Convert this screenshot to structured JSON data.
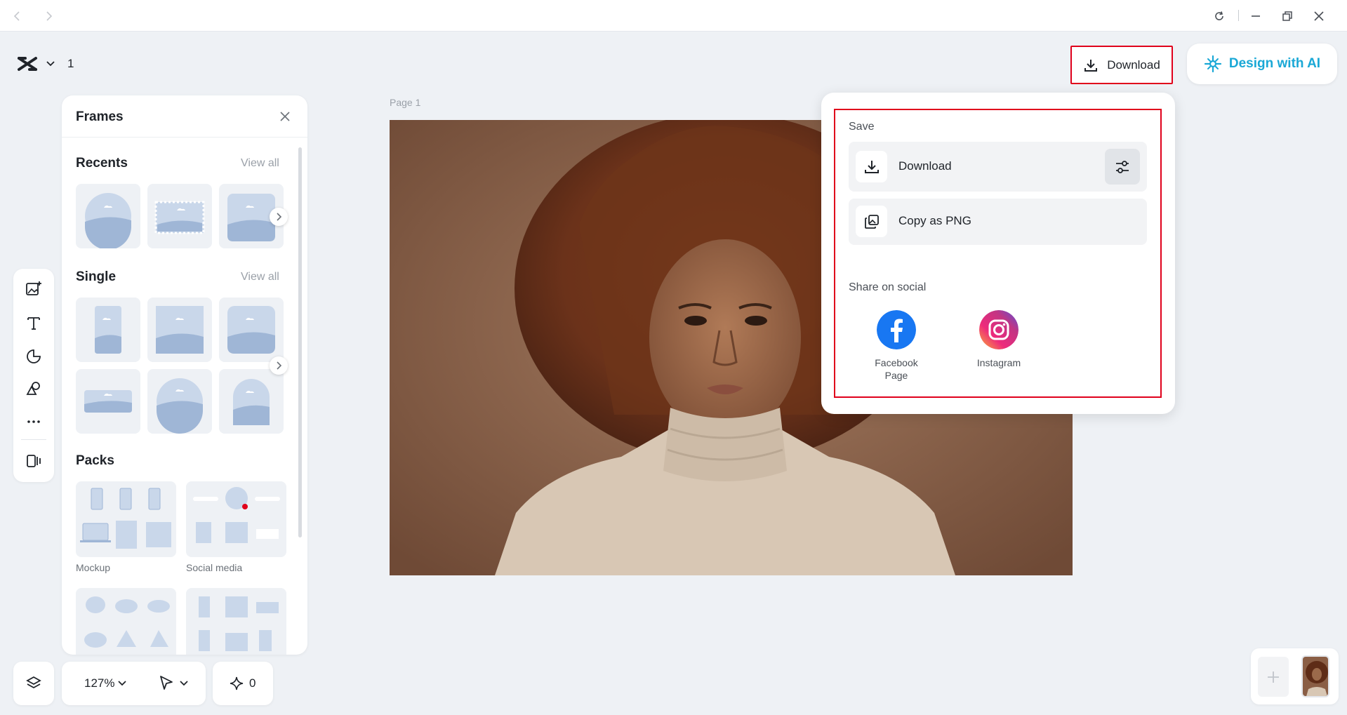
{
  "brand": {
    "page_count": "1"
  },
  "header": {
    "download_label": "Download",
    "design_ai_label": "Design with AI",
    "accent_color": "#1aa8d6",
    "highlight_color": "#e0001b"
  },
  "toolbar": {
    "items": [
      "image-add-icon",
      "text-icon",
      "shapes-icon",
      "elements-icon",
      "more-icon",
      "frames-panel-icon"
    ]
  },
  "frames_panel": {
    "title": "Frames",
    "recents_title": "Recents",
    "single_title": "Single",
    "packs_title": "Packs",
    "view_all": "View all",
    "packs": [
      {
        "label": "Mockup"
      },
      {
        "label": "Social media"
      }
    ]
  },
  "canvas": {
    "page_label": "Page 1"
  },
  "download_menu": {
    "save_label": "Save",
    "download_label": "Download",
    "copy_label": "Copy as PNG",
    "share_label": "Share on social",
    "socials": [
      {
        "name": "Facebook Page",
        "line1": "Facebook",
        "line2": "Page",
        "color": "#1877f2"
      },
      {
        "name": "Instagram",
        "line1": "Instagram",
        "line2": ""
      }
    ]
  },
  "bottom": {
    "zoom": "127%",
    "credits": "0"
  }
}
